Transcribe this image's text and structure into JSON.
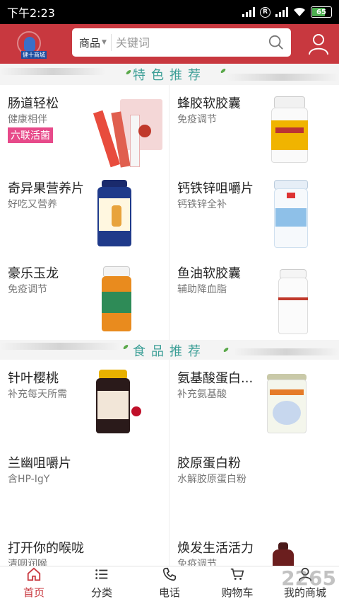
{
  "status_bar": {
    "time": "下午2:23",
    "battery": "65"
  },
  "header": {
    "logo_text": "健十商城",
    "search": {
      "category": "商品",
      "placeholder": "关键词"
    }
  },
  "sections": [
    {
      "title": "特色推荐",
      "products": [
        {
          "name": "肠道轻松",
          "desc": "健康相伴",
          "badge": "六联活菌"
        },
        {
          "name": "蜂胶软胶囊",
          "desc": "免疫调节"
        },
        {
          "name": "奇异果营养片",
          "desc": "好吃又营养"
        },
        {
          "name": "钙铁锌咀嚼片",
          "desc": "钙铁锌全补"
        },
        {
          "name": "豪乐玉龙",
          "desc": "免疫调节"
        },
        {
          "name": "鱼油软胶囊",
          "desc": "辅助降血脂"
        }
      ]
    },
    {
      "title": "食品推荐",
      "products": [
        {
          "name": "针叶樱桃",
          "desc": "补充每天所需"
        },
        {
          "name": "氨基酸蛋白...",
          "desc": "补充氨基酸"
        },
        {
          "name": "兰幽咀嚼片",
          "desc": "含HP-IgY"
        },
        {
          "name": "胶原蛋白粉",
          "desc": "水解胶原蛋白粉"
        },
        {
          "name": "打开你的喉咙",
          "desc": "清咽润喉"
        },
        {
          "name": "焕发生活活力",
          "desc": "免疫调节"
        }
      ]
    }
  ],
  "bottom_nav": [
    {
      "label": "首页",
      "icon": "home-icon",
      "active": true
    },
    {
      "label": "分类",
      "icon": "list-icon"
    },
    {
      "label": "电话",
      "icon": "phone-icon"
    },
    {
      "label": "购物车",
      "icon": "cart-icon"
    },
    {
      "label": "我的商城",
      "icon": "user-icon"
    }
  ],
  "watermark": "2265",
  "colors": {
    "brand_red": "#c8383f",
    "section_title": "#3b9e96",
    "badge_pink": "#e74a8a"
  }
}
